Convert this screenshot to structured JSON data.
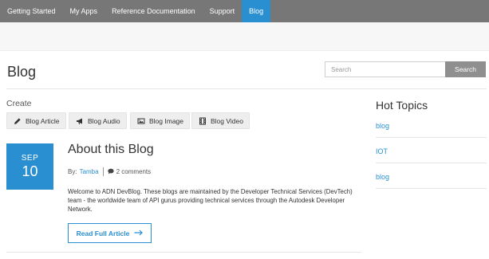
{
  "nav": {
    "items": [
      {
        "label": "Getting Started"
      },
      {
        "label": "My Apps"
      },
      {
        "label": "Reference Documentation"
      },
      {
        "label": "Support"
      },
      {
        "label": "Blog"
      }
    ],
    "active": "Blog"
  },
  "page": {
    "title": "Blog"
  },
  "search": {
    "placeholder": "Search",
    "button_label": "Search"
  },
  "create": {
    "label": "Create",
    "buttons": [
      {
        "label": "Blog Article",
        "icon": "pencil-icon"
      },
      {
        "label": "Blog Audio",
        "icon": "megaphone-icon"
      },
      {
        "label": "Blog Image",
        "icon": "image-icon"
      },
      {
        "label": "Blog Video",
        "icon": "film-icon"
      }
    ]
  },
  "post": {
    "month": "SEP",
    "day": "10",
    "title": "About this Blog",
    "by_label": "By:",
    "author": "Tamba",
    "comments": "2 comments",
    "body": "Welcome to ADN DevBlog. These blogs are maintained by the Developer Technical Services (DevTech) team - the worldwide team of API gurus providing technical services through the Autodesk Developer Network.",
    "read_more": "Read Full Article"
  },
  "hot_topics": {
    "title": "Hot Topics",
    "items": [
      "blog",
      "IOT",
      "blog"
    ]
  },
  "colors": {
    "accent": "#2a8fd0",
    "nav_bg": "#777777",
    "search_button_bg": "#8f8f8f"
  }
}
